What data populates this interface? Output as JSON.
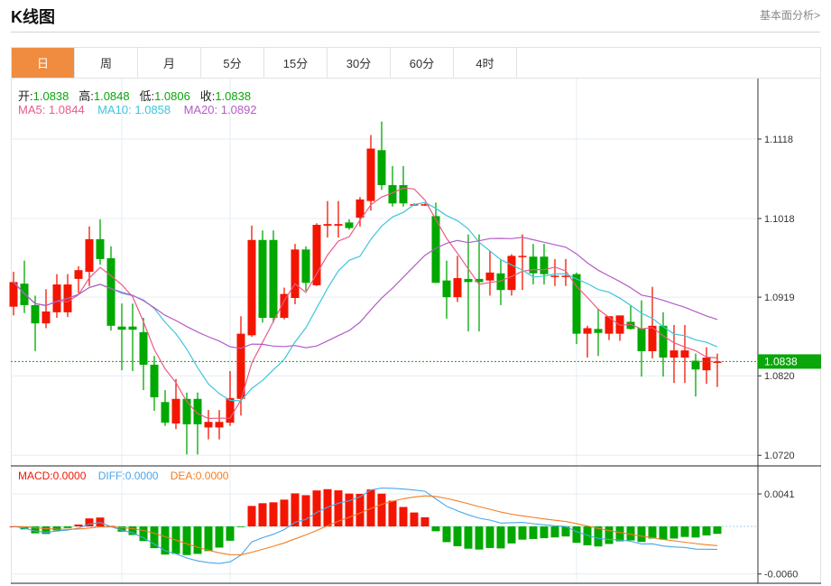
{
  "header": {
    "title": "K线图",
    "more_link": "基本面分析>"
  },
  "tabs": [
    {
      "label": "日",
      "active": true
    },
    {
      "label": "周"
    },
    {
      "label": "月"
    },
    {
      "label": "5分"
    },
    {
      "label": "15分"
    },
    {
      "label": "30分"
    },
    {
      "label": "60分"
    },
    {
      "label": "4时"
    }
  ],
  "ohlc_legend": {
    "open_label": "开:",
    "open": "1.0838",
    "high_label": "高:",
    "high": "1.0848",
    "low_label": "低:",
    "low": "1.0806",
    "close_label": "收:",
    "close": "1.0838"
  },
  "ma_legend": {
    "ma5": "MA5: 1.0844",
    "ma10": "MA10: 1.0858",
    "ma20": "MA20: 1.0892"
  },
  "macd_legend": {
    "macd": "MACD:0.0000",
    "diff": "DIFF:0.0000",
    "dea": "DEA:0.0000"
  },
  "colors": {
    "up": "#f31500",
    "down": "#00a800",
    "active_tab": "#f08c3f",
    "ma5": "#ec5a86",
    "ma10": "#3ec6dc",
    "ma20": "#b45cc6",
    "diff": "#4aa6ea",
    "dea": "#f37d22",
    "current_price": "#0aa60a"
  },
  "chart_data": [
    {
      "type": "candlestick",
      "price_axis": {
        "ticks": [
          "1.1118",
          "1.1018",
          "1.0919",
          "1.0820",
          "1.0720"
        ],
        "range": [
          1.0661,
          1.1219
        ]
      },
      "current_price": "1.0838",
      "grid": true,
      "ohlc": [
        [
          1.0907,
          1.0951,
          1.0896,
          1.0938
        ],
        [
          1.0936,
          1.0965,
          1.0899,
          1.0909
        ],
        [
          1.0909,
          1.0921,
          1.0851,
          1.0886
        ],
        [
          1.0886,
          1.0929,
          1.088,
          1.0901
        ],
        [
          1.09,
          1.0948,
          1.0893,
          1.0935
        ],
        [
          1.09,
          1.0948,
          1.0894,
          1.0935
        ],
        [
          1.0942,
          1.0958,
          1.0924,
          1.0953
        ],
        [
          1.0951,
          1.1008,
          1.0933,
          1.0992
        ],
        [
          1.0992,
          1.1017,
          1.096,
          1.0967
        ],
        [
          1.0968,
          1.0983,
          1.0877,
          1.0883
        ],
        [
          1.0882,
          1.0911,
          1.0827,
          1.0878
        ],
        [
          1.0882,
          1.0911,
          1.0826,
          1.0878
        ],
        [
          1.0875,
          1.0893,
          1.0802,
          1.0834
        ],
        [
          1.0834,
          1.0845,
          1.0776,
          1.0793
        ],
        [
          1.0787,
          1.0802,
          1.0757,
          1.0761
        ],
        [
          1.076,
          1.0816,
          1.0753,
          1.0791
        ],
        [
          1.0791,
          1.0799,
          1.0721,
          1.0759
        ],
        [
          1.0791,
          1.0799,
          1.0721,
          1.0759
        ],
        [
          1.0755,
          1.0777,
          1.074,
          1.0762
        ],
        [
          1.0755,
          1.0777,
          1.074,
          1.0762
        ],
        [
          1.0761,
          1.0826,
          1.0757,
          1.0792
        ],
        [
          1.0791,
          1.0895,
          1.077,
          1.0873
        ],
        [
          1.0871,
          1.1009,
          1.0869,
          1.0991
        ],
        [
          1.0991,
          1.1003,
          1.0887,
          1.0893
        ],
        [
          1.0991,
          1.1003,
          1.0887,
          1.0893
        ],
        [
          1.0893,
          1.0931,
          1.0891,
          1.0923
        ],
        [
          1.0918,
          1.0986,
          1.091,
          1.0979
        ],
        [
          1.0979,
          1.0983,
          1.0927,
          1.0937
        ],
        [
          1.0934,
          1.1012,
          1.0933,
          1.101
        ],
        [
          1.1009,
          1.104,
          1.0994,
          1.1011
        ],
        [
          1.1009,
          1.104,
          1.0994,
          1.1011
        ],
        [
          1.1013,
          1.1017,
          1.1004,
          1.1006
        ],
        [
          1.1019,
          1.1045,
          1.1008,
          1.1042
        ],
        [
          1.104,
          1.1123,
          1.1028,
          1.1106
        ],
        [
          1.1104,
          1.114,
          1.1054,
          1.106
        ],
        [
          1.106,
          1.1084,
          1.1033,
          1.1037
        ],
        [
          1.106,
          1.1084,
          1.1033,
          1.1037
        ],
        [
          1.1035,
          1.1037,
          1.1034,
          1.1036
        ],
        [
          1.1035,
          1.1037,
          1.1034,
          1.1036
        ],
        [
          1.1021,
          1.1038,
          1.0937,
          1.0937
        ],
        [
          1.094,
          1.0965,
          1.0892,
          1.0919
        ],
        [
          1.0919,
          1.0971,
          1.0913,
          1.0943
        ],
        [
          1.0942,
          1.0998,
          1.0876,
          1.0938
        ],
        [
          1.0942,
          1.0998,
          1.0876,
          1.0938
        ],
        [
          1.094,
          1.0977,
          1.0921,
          1.095
        ],
        [
          1.0949,
          1.0966,
          1.0909,
          1.0928
        ],
        [
          1.0928,
          1.0973,
          1.0921,
          1.0971
        ],
        [
          1.097,
          1.0998,
          1.0928,
          1.0971
        ],
        [
          1.097,
          1.0986,
          1.0935,
          1.0949
        ],
        [
          1.097,
          1.0986,
          1.0935,
          1.0948
        ],
        [
          1.0945,
          1.0967,
          1.0933,
          1.0946
        ],
        [
          1.0945,
          1.0967,
          1.0933,
          1.0946
        ],
        [
          1.0948,
          1.095,
          1.086,
          1.0873
        ],
        [
          1.0873,
          1.0883,
          1.0843,
          1.088
        ],
        [
          1.0879,
          1.0904,
          1.0845,
          1.0874
        ],
        [
          1.0873,
          1.0895,
          1.0865,
          1.0895
        ],
        [
          1.0873,
          1.0896,
          1.0864,
          1.0896
        ],
        [
          1.0888,
          1.0909,
          1.0878,
          1.0879
        ],
        [
          1.088,
          1.0915,
          1.0819,
          1.0851
        ],
        [
          1.0851,
          1.0932,
          1.0842,
          1.0883
        ],
        [
          1.0883,
          1.09,
          1.0819,
          1.0843
        ],
        [
          1.0843,
          1.0884,
          1.0811,
          1.0852
        ],
        [
          1.0843,
          1.0884,
          1.0811,
          1.0852
        ],
        [
          1.0839,
          1.0848,
          1.0794,
          1.0828
        ],
        [
          1.0827,
          1.0856,
          1.081,
          1.0843
        ],
        [
          1.0838,
          1.0848,
          1.0806,
          1.0838
        ]
      ],
      "moving_averages": [
        "MA5",
        "MA10",
        "MA20"
      ]
    },
    {
      "type": "bar+line",
      "indicator": "MACD",
      "axis": {
        "ticks": [
          "0.0041",
          "-0.0060"
        ]
      }
    }
  ]
}
